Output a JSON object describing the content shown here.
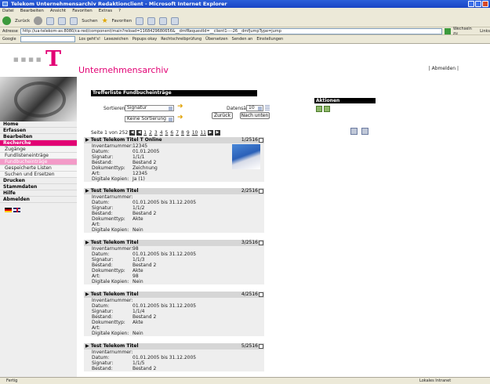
{
  "window": {
    "title": "Telekom Unternehmensarchiv Redaktionclient - Microsoft Internet Explorer"
  },
  "menu": [
    "Datei",
    "Bearbeiten",
    "Ansicht",
    "Favoriten",
    "Extras",
    "?"
  ],
  "toolbar": {
    "back": "Zurück",
    "search": "Suchen",
    "favorites": "Favoriten"
  },
  "address": {
    "label": "Adresse",
    "url": "http://ua-telekom-as:8080/ca-red/component/main?reload=1168429680656&__dmfRequestId=__client1----26__dmfJumpType=jump",
    "go": "Wechseln zu",
    "links": "Links"
  },
  "googlebar": {
    "label": "Google",
    "go": "Los geht's!",
    "bookmarks": "Lesezeichen",
    "popups": "Popups okay",
    "spell": "Rechtschreibprüfung",
    "translate": "Übersetzen",
    "send": "Senden an",
    "settings": "Einstellungen"
  },
  "nav": [
    {
      "label": "Home",
      "sub": false
    },
    {
      "label": "Erfassen",
      "sub": false
    },
    {
      "label": "Bearbeiten",
      "sub": false
    },
    {
      "label": "Recherche",
      "sub": false,
      "active": true
    },
    {
      "label": "Zugänge",
      "sub": true
    },
    {
      "label": "Fundlisteneinträge",
      "sub": true
    },
    {
      "label": "Fundbucheinträge",
      "sub": true,
      "hl": true
    },
    {
      "label": "Gespeicherte Listen",
      "sub": true
    },
    {
      "label": "Suchen und Ersetzen",
      "sub": true
    },
    {
      "label": "Drucken",
      "sub": false
    },
    {
      "label": "Stammdaten",
      "sub": false
    },
    {
      "label": "Hilfe",
      "sub": false
    },
    {
      "label": "Abmelden",
      "sub": false
    }
  ],
  "header": {
    "title": "Unternehmensarchiv",
    "logout": "| Abmelden |"
  },
  "list": {
    "title": "Trefferliste Fundbucheinträge",
    "back": "Zurück",
    "next": "Nach unten",
    "sort_label": "Sortieren nach",
    "sort1": "Signatur",
    "sort2": "Keine Sortierung",
    "records_label": "Datensätze",
    "records_value": "10"
  },
  "aktionen": "Aktionen",
  "paging": {
    "text": "Seite 1 von 252",
    "pages": [
      "1",
      "2",
      "3",
      "4",
      "5",
      "6",
      "7",
      "8",
      "9",
      "10",
      "11"
    ]
  },
  "records": [
    {
      "title": "Test Telekom Titel T Online",
      "count": "1/2516",
      "thumb": true,
      "fields": [
        [
          "Inventarnummer:",
          "12345"
        ],
        [
          "Datum:",
          "01.01.2005"
        ],
        [
          "Signatur:",
          "1/1/1"
        ],
        [
          "Bestand:",
          "Bestand 2"
        ],
        [
          "Dokumenttyp:",
          "Zeichnung"
        ],
        [
          "Art:",
          "12345"
        ],
        [
          "Digitale Kopien:",
          "Ja (1)"
        ]
      ]
    },
    {
      "title": "Test Telekom Titel",
      "count": "2/2516",
      "thumb": false,
      "fields": [
        [
          "Inventarnummer:",
          ""
        ],
        [
          "Datum:",
          "01.01.2005 bis 31.12.2005"
        ],
        [
          "Signatur:",
          "1/1/2"
        ],
        [
          "Bestand:",
          "Bestand 2"
        ],
        [
          "Dokumenttyp:",
          "Akte"
        ],
        [
          "Art:",
          ""
        ],
        [
          "Digitale Kopien:",
          "Nein"
        ]
      ]
    },
    {
      "title": "Test Telekom Titel",
      "count": "3/2516",
      "thumb": false,
      "fields": [
        [
          "Inventarnummer:",
          "98"
        ],
        [
          "Datum:",
          "01.01.2005 bis 31.12.2005"
        ],
        [
          "Signatur:",
          "1/1/3"
        ],
        [
          "Bestand:",
          "Bestand 2"
        ],
        [
          "Dokumenttyp:",
          "Akte"
        ],
        [
          "Art:",
          "98"
        ],
        [
          "Digitale Kopien:",
          "Nein"
        ]
      ]
    },
    {
      "title": "Test Telekom Titel",
      "count": "4/2516",
      "thumb": false,
      "fields": [
        [
          "Inventarnummer:",
          ""
        ],
        [
          "Datum:",
          "01.01.2005 bis 31.12.2005"
        ],
        [
          "Signatur:",
          "1/1/4"
        ],
        [
          "Bestand:",
          "Bestand 2"
        ],
        [
          "Dokumenttyp:",
          "Akte"
        ],
        [
          "Art:",
          ""
        ],
        [
          "Digitale Kopien:",
          "Nein"
        ]
      ]
    },
    {
      "title": "Test Telekom Titel",
      "count": "5/2516",
      "thumb": false,
      "fields": [
        [
          "Inventarnummer:",
          ""
        ],
        [
          "Datum:",
          "01.01.2005 bis 31.12.2005"
        ],
        [
          "Signatur:",
          "1/1/5"
        ],
        [
          "Bestand:",
          "Bestand 2"
        ]
      ]
    }
  ],
  "status": {
    "left": "Fertig",
    "zone": "Lokales Intranet"
  }
}
